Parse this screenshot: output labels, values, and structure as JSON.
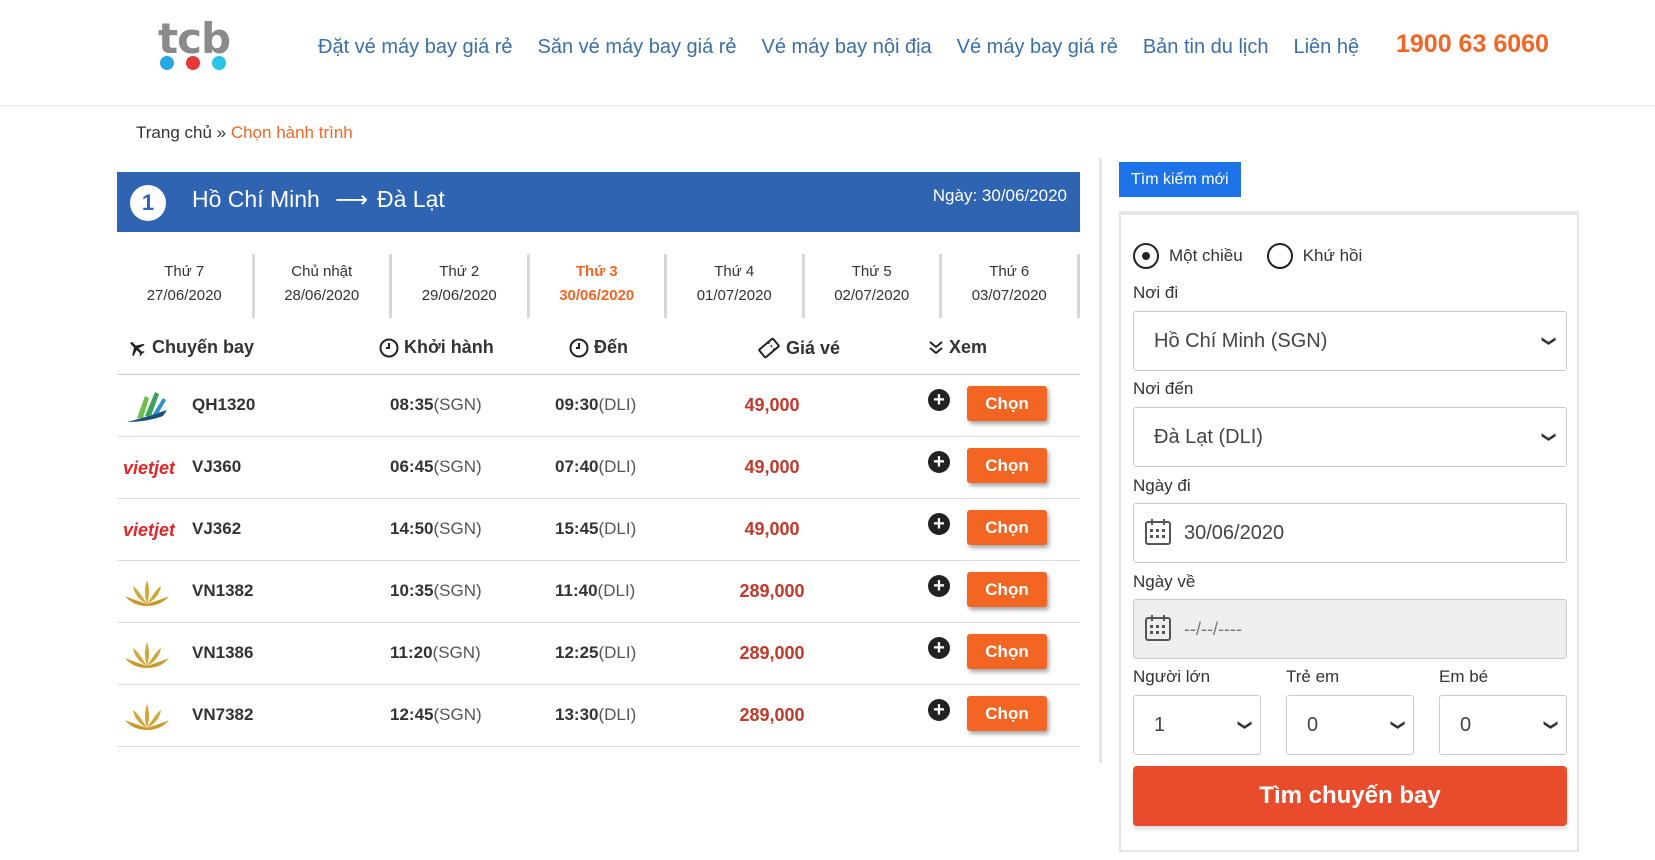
{
  "header": {
    "logo_text": "tcb",
    "logo_dots": [
      "#29a8e0",
      "#e53935",
      "#29c4e8"
    ],
    "nav": [
      "Đặt vé máy bay giá rẻ",
      "Săn vé máy bay giá rẻ",
      "Vé máy bay nội địa",
      "Vé máy bay giá rẻ",
      "Bản tin du lịch",
      "Liên hệ"
    ],
    "hotline": "1900 63 6060"
  },
  "breadcrumb": {
    "home": "Trang chủ",
    "separator": " » ",
    "current": "Chọn hành trình"
  },
  "route": {
    "number": "1",
    "from": "Hồ Chí Minh",
    "arrow": "⟶",
    "to": "Đà Lạt",
    "date": "Ngày: 30/06/2020"
  },
  "date_tabs": [
    {
      "day": "Thứ 7",
      "date": "27/06/2020",
      "active": false
    },
    {
      "day": "Chủ nhật",
      "date": "28/06/2020",
      "active": false
    },
    {
      "day": "Thứ 2",
      "date": "29/06/2020",
      "active": false
    },
    {
      "day": "Thứ 3",
      "date": "30/06/2020",
      "active": true
    },
    {
      "day": "Thứ 4",
      "date": "01/07/2020",
      "active": false
    },
    {
      "day": "Thứ 5",
      "date": "02/07/2020",
      "active": false
    },
    {
      "day": "Thứ 6",
      "date": "03/07/2020",
      "active": false
    }
  ],
  "table_header": {
    "flight": "Chuyến bay",
    "departure": "Khởi hành",
    "arrival": "Đến",
    "price": "Giá vé",
    "view": "Xem"
  },
  "flights": [
    {
      "airline": "bamboo",
      "code": "QH1320",
      "dep_time": "08:35",
      "dep_airport": "(SGN)",
      "arr_time": "09:30",
      "arr_airport": "(DLI)",
      "price": "49,000",
      "button": "Chọn"
    },
    {
      "airline": "vietjet",
      "code": "VJ360",
      "dep_time": "06:45",
      "dep_airport": "(SGN)",
      "arr_time": "07:40",
      "arr_airport": "(DLI)",
      "price": "49,000",
      "button": "Chọn"
    },
    {
      "airline": "vietjet",
      "code": "VJ362",
      "dep_time": "14:50",
      "dep_airport": "(SGN)",
      "arr_time": "15:45",
      "arr_airport": "(DLI)",
      "price": "49,000",
      "button": "Chọn"
    },
    {
      "airline": "vietnam-airlines",
      "code": "VN1382",
      "dep_time": "10:35",
      "dep_airport": "(SGN)",
      "arr_time": "11:40",
      "arr_airport": "(DLI)",
      "price": "289,000",
      "button": "Chọn"
    },
    {
      "airline": "vietnam-airlines",
      "code": "VN1386",
      "dep_time": "11:20",
      "dep_airport": "(SGN)",
      "arr_time": "12:25",
      "arr_airport": "(DLI)",
      "price": "289,000",
      "button": "Chọn"
    },
    {
      "airline": "vietnam-airlines",
      "code": "VN7382",
      "dep_time": "12:45",
      "dep_airport": "(SGN)",
      "arr_time": "13:30",
      "arr_airport": "(DLI)",
      "price": "289,000",
      "button": "Chọn"
    }
  ],
  "vietjet_logo_text": "vietjet",
  "sidebar": {
    "tab_label": "Tìm kiếm mới",
    "trip_one_way": "Một chiều",
    "trip_round": "Khứ hồi",
    "from_label": "Nơi đi",
    "from_value": "Hồ Chí Minh (SGN)",
    "to_label": "Nơi đến",
    "to_value": "Đà Lạt (DLI)",
    "depart_label": "Ngày đi",
    "depart_value": "30/06/2020",
    "return_label": "Ngày về",
    "return_value": "--/--/----",
    "adults_label": "Người lớn",
    "adults_value": "1",
    "children_label": "Trẻ em",
    "children_value": "0",
    "infants_label": "Em bé",
    "infants_value": "0",
    "search_button": "Tìm chuyến bay"
  },
  "colors": {
    "accent_orange": "#f26522",
    "route_blue": "#2f64b3",
    "nav_blue": "#3a6ea8",
    "search_red": "#e84c2c",
    "tab_blue": "#1e73e8"
  }
}
